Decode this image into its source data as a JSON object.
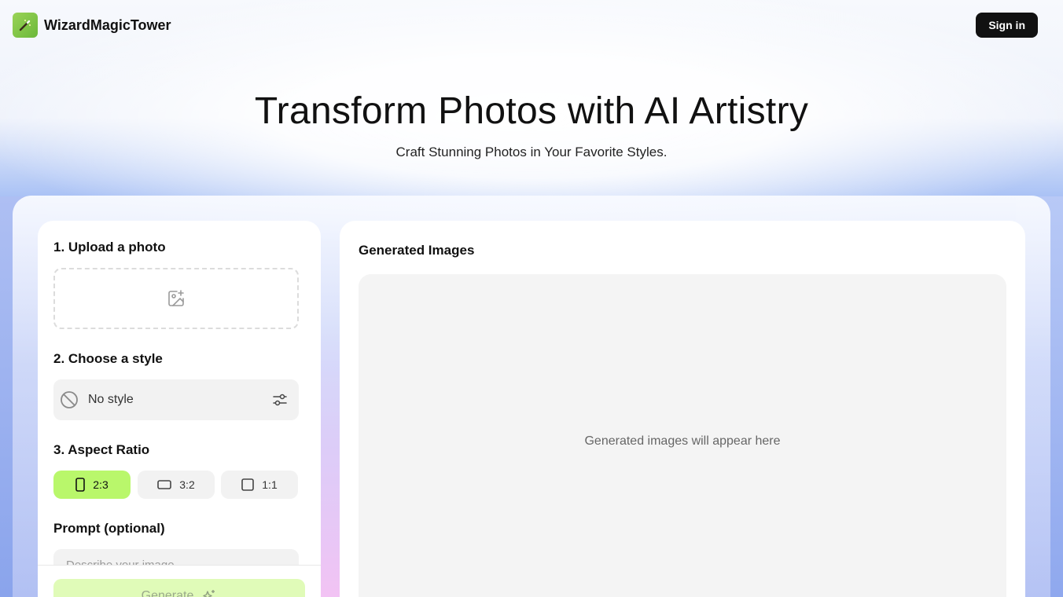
{
  "header": {
    "brand": "WizardMagicTower",
    "sign_in": "Sign in"
  },
  "hero": {
    "title": "Transform Photos with AI Artistry",
    "subtitle": "Craft Stunning Photos in Your Favorite Styles."
  },
  "form": {
    "upload_title": "1. Upload a photo",
    "style_title": "2. Choose a style",
    "style_value": "No style",
    "ratio_title": "3. Aspect Ratio",
    "ratios": [
      {
        "label": "2:3",
        "active": true
      },
      {
        "label": "3:2",
        "active": false
      },
      {
        "label": "1:1",
        "active": false
      }
    ],
    "prompt_title": "Prompt (optional)",
    "prompt_placeholder": "Describe your image...",
    "generate_label": "Generate"
  },
  "output": {
    "title": "Generated Images",
    "empty_text": "Generated images will appear here"
  },
  "icons": [
    "magic-wand-icon",
    "image-plus-icon",
    "ban-icon",
    "sliders-icon",
    "portrait-icon",
    "landscape-icon",
    "square-icon",
    "sparkles-icon"
  ],
  "colors": {
    "accent": "#b9f76b",
    "accent_disabled": "#e0fbb8",
    "dark": "#111111"
  }
}
